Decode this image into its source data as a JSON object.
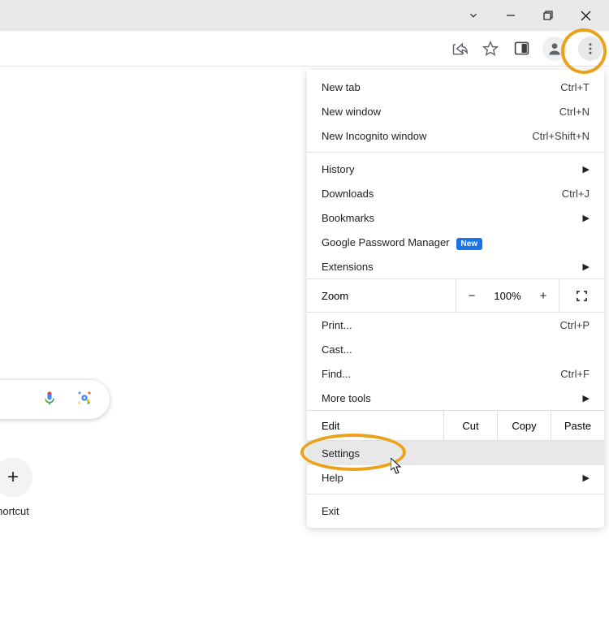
{
  "window": {
    "caret": "⌄"
  },
  "toolbar": {
    "share": "share-icon",
    "bookmark": "bookmark-icon",
    "side_panel": "side-panel-icon",
    "profile": "profile-icon",
    "kebab": "kebab-icon"
  },
  "search": {
    "mic": "mic-icon",
    "lens": "lens-icon"
  },
  "shortcut": {
    "label": "hortcut",
    "plus": "+"
  },
  "menu": {
    "new_tab": {
      "label": "New tab",
      "hint": "Ctrl+T"
    },
    "new_window": {
      "label": "New window",
      "hint": "Ctrl+N"
    },
    "incognito": {
      "label": "New Incognito window",
      "hint": "Ctrl+Shift+N"
    },
    "history": {
      "label": "History"
    },
    "downloads": {
      "label": "Downloads",
      "hint": "Ctrl+J"
    },
    "bookmarks": {
      "label": "Bookmarks"
    },
    "password": {
      "label": "Google Password Manager",
      "badge": "New"
    },
    "extensions": {
      "label": "Extensions"
    },
    "zoom": {
      "label": "Zoom",
      "value": "100%",
      "minus": "−",
      "plus": "+"
    },
    "print": {
      "label": "Print...",
      "hint": "Ctrl+P"
    },
    "cast": {
      "label": "Cast..."
    },
    "find": {
      "label": "Find...",
      "hint": "Ctrl+F"
    },
    "more_tools": {
      "label": "More tools"
    },
    "edit": {
      "label": "Edit",
      "cut": "Cut",
      "copy": "Copy",
      "paste": "Paste"
    },
    "settings": {
      "label": "Settings"
    },
    "help": {
      "label": "Help"
    },
    "exit": {
      "label": "Exit"
    }
  }
}
